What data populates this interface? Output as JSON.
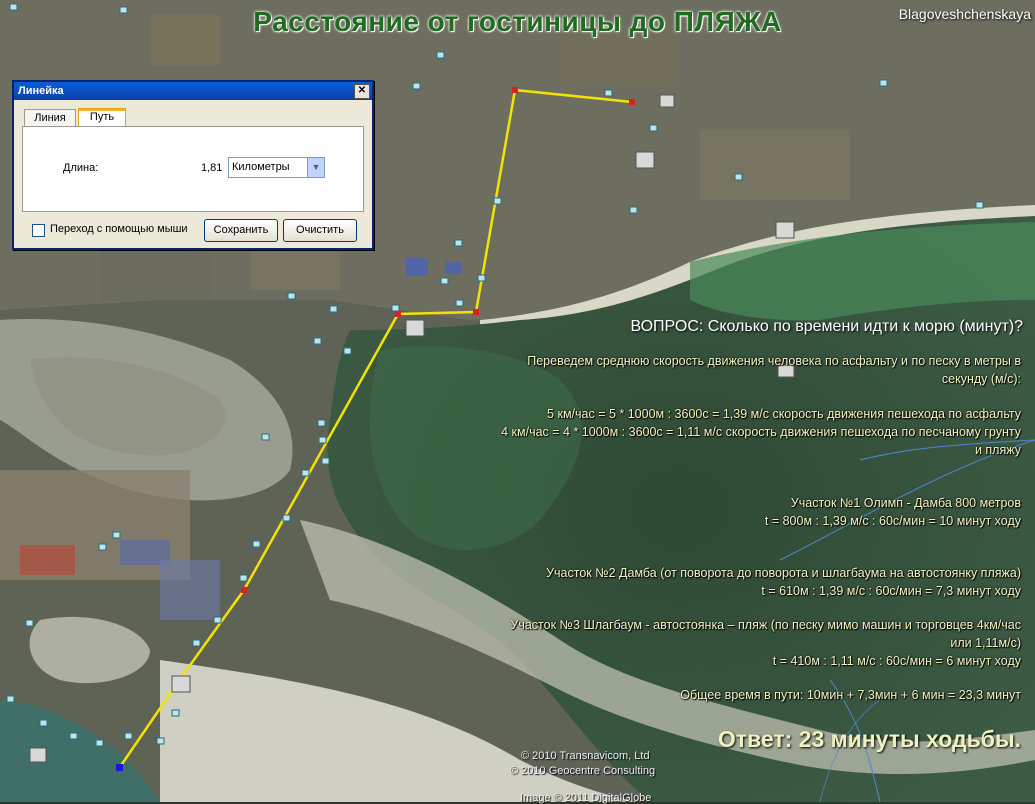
{
  "title": "Расстояние от  гостиницы  до ПЛЯЖА",
  "place_label": "Blagoveshchenskaya",
  "dialog": {
    "title": "Линейка",
    "tab_line": "Линия",
    "tab_path": "Путь",
    "length_label": "Длина:",
    "length_value": "1,81",
    "units": "Километры",
    "mouse_nav": "Переход с помощью мыши",
    "save": "Сохранить",
    "clear": "Очистить"
  },
  "annotations": {
    "question": "ВОПРОС:  Сколько по времени идти к морю (минут)?",
    "intro_1": "Переведем среднюю скорость движения человека по асфальту и по песку в метры в",
    "intro_2": "секунду (м/с):",
    "speed_asphalt": "5 км/час = 5 * 1000м : 3600с = 1,39 м/с скорость движения пешехода по асфальту",
    "speed_sand_1": "4 км/час = 4 * 1000м : 3600с = 1,11 м/с скорость движения пешехода по песчаному грунту",
    "speed_sand_2": "и пляжу",
    "leg1_title": "Участок №1  Олимп - Дамба 800 метров",
    "leg1_calc": "t = 800м : 1,39 м/с : 60с/мин = 10 минут ходу",
    "leg2_title": "Участок №2  Дамба  (от поворота до поворота и шлагбаума на автостоянку пляжа)",
    "leg2_calc": "t = 610м : 1,39 м/с : 60с/мин = 7,3 минут ходу",
    "leg3_title_1": "Участок №3  Шлагбаум - автостоянка – пляж (по песку мимо машин и торговцев 4км/час",
    "leg3_title_2": "или 1,11м/с)",
    "leg3_calc": "t = 410м : 1,11 м/с : 60с/мин = 6 минут ходу",
    "total": "Общее время в пути: 10мин + 7,3мин + 6 мин = 23,3 минут",
    "answer": "Ответ:  23 минуты  ходьбы."
  },
  "copyright": {
    "line1": "© 2010 Transnavicom, Ltd",
    "line2": "© 2010 Geocentre Consulting",
    "line3": "Image © 2011 DigitalGlobe"
  },
  "colors": {
    "route": "#f2e400",
    "title": "#1f6b1f",
    "route_node": "#e02020",
    "end_node": "#1a1ad0"
  }
}
